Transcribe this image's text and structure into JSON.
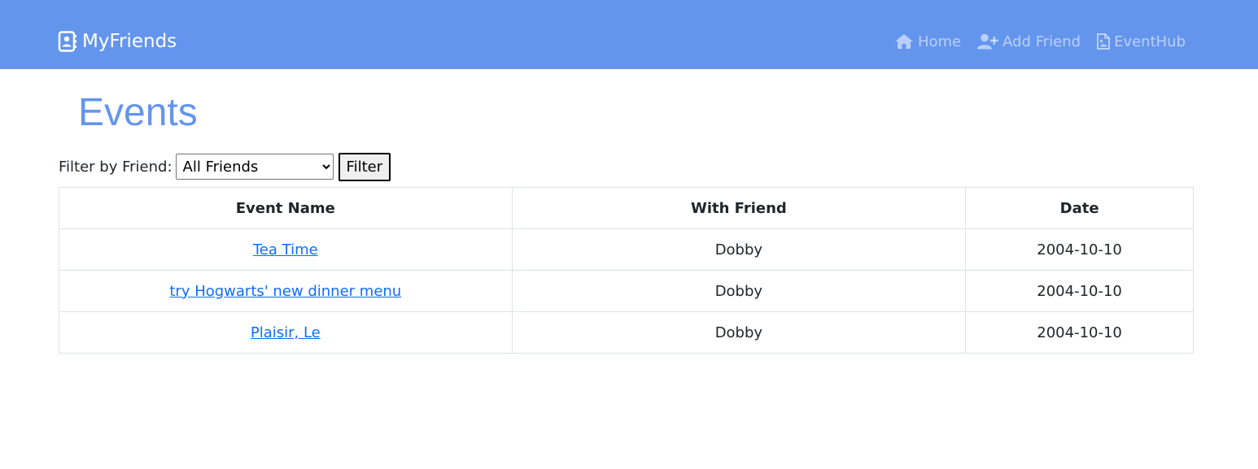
{
  "navbar": {
    "brand": {
      "label": "MyFriends",
      "icon": "address-book-icon"
    },
    "links": [
      {
        "label": "Home",
        "icon": "home-icon"
      },
      {
        "label": "Add Friend",
        "icon": "user-plus-icon"
      },
      {
        "label": "EventHub",
        "icon": "file-image-icon"
      }
    ]
  },
  "page": {
    "title": "Events"
  },
  "filter": {
    "label": "Filter by Friend:",
    "selected": "All Friends",
    "button_label": "Filter"
  },
  "table": {
    "headers": [
      "Event Name",
      "With Friend",
      "Date"
    ],
    "rows": [
      {
        "event": "Tea Time",
        "friend": "Dobby",
        "date": "2004-10-10"
      },
      {
        "event": "try Hogwarts' new dinner menu",
        "friend": "Dobby",
        "date": "2004-10-10"
      },
      {
        "event": "Plaisir, Le",
        "friend": "Dobby",
        "date": "2004-10-10"
      }
    ]
  },
  "colors": {
    "navbar": "#6495ed",
    "title": "#6495ed",
    "link": "#0d6efd"
  }
}
